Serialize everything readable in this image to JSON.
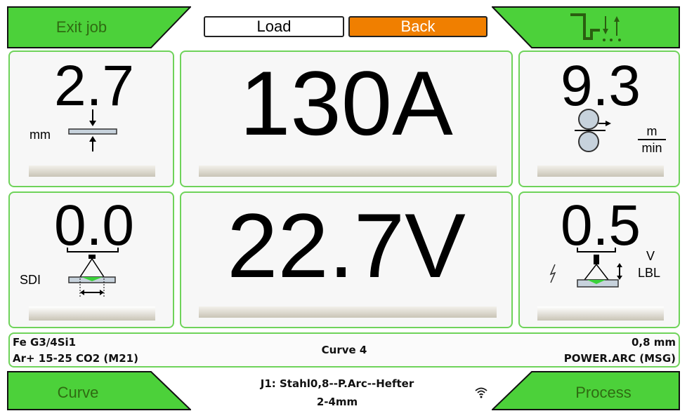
{
  "softkeys": {
    "top_left": "Exit job",
    "bottom_left": "Curve",
    "bottom_right": "Process",
    "top_right_icon": "sequence-steps-icon"
  },
  "buttons": {
    "load": "Load",
    "back": "Back"
  },
  "params": {
    "thickness": {
      "value": "2.7",
      "unit": "mm"
    },
    "current": {
      "value": "130A"
    },
    "wire_speed": {
      "value": "9.3",
      "unit_num": "m",
      "unit_den": "min"
    },
    "sdi": {
      "value": "0.0",
      "label": "SDI"
    },
    "voltage": {
      "value": "22.7V"
    },
    "arc_length": {
      "value": "0.5",
      "unit": "V",
      "label": "LBL"
    }
  },
  "info": {
    "material": "Fe G3/4Si1",
    "gas": "Ar+ 15-25 CO2 (M21)",
    "curve": "Curve 4",
    "wire_diameter": "0,8 mm",
    "process": "POWER.ARC (MSG)"
  },
  "job": {
    "line1": "J1: Stahl0,8--P.Arc--Hefter",
    "line2": "2-4mm"
  },
  "status": {
    "wifi_icon": "wifi-icon"
  },
  "colors": {
    "green": "#4cd13a",
    "panel_border": "#6fd35a",
    "back": "#f07f00"
  }
}
